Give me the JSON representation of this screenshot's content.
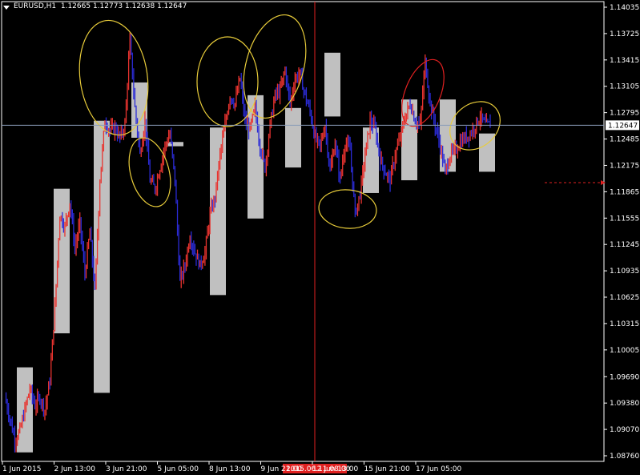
{
  "header": {
    "symbol": "EURUSD,H1",
    "ohlc": "1.12665 1.12773 1.12638 1.12647"
  },
  "colors": {
    "background": "#000000",
    "axis": "#ffffff",
    "bull_candle": "#e8332f",
    "bear_candle": "#2b2bd6",
    "box_fill": "#c0c0c0",
    "ellipse_yellow": "#e8cc3a",
    "ellipse_red": "#e02020",
    "crosshair": "#e02020",
    "current_price_line": "#8a9bb8",
    "price_tag_bg": "#ffffff"
  },
  "chart_data": {
    "type": "candlestick",
    "timeframe": "H1",
    "y_range": [
      1.0876,
      1.14035
    ],
    "price_ticks": [
      "1.14035",
      "1.13725",
      "1.13415",
      "1.13105",
      "1.12795",
      "1.12485",
      "1.12175",
      "1.11865",
      "1.11555",
      "1.11245",
      "1.10935",
      "1.10625",
      "1.10315",
      "1.10005",
      "1.09690",
      "1.09380",
      "1.09070",
      "1.08760"
    ],
    "time_ticks": [
      "1 Jun 2015",
      "2 Jun 13:00",
      "3 Jun 21:00",
      "5 Jun 05:00",
      "8 Jun 13:00",
      "9 Jun 21:00",
      "12 Jun 13:00",
      "15 Jun 21:00",
      "17 Jun 05:00"
    ],
    "current_price": "1.12647",
    "crosshair_time_label": "2015.06.11 08:00",
    "daily_range_boxes": [
      {
        "open": 1.098,
        "close": 1.088
      },
      {
        "open": 1.102,
        "close": 1.119
      },
      {
        "open": 1.095,
        "close": 1.127
      },
      {
        "open": 1.125,
        "close": 1.1315
      },
      {
        "open": 1.124,
        "close": 1.1245
      },
      {
        "open": 1.1262,
        "close": 1.1065
      },
      {
        "open": 1.1155,
        "close": 1.13
      },
      {
        "open": 1.1215,
        "close": 1.1285
      },
      {
        "open": 1.1275,
        "close": 1.135
      },
      {
        "open": 1.1262,
        "close": 1.1185
      },
      {
        "open": 1.12,
        "close": 1.1295
      },
      {
        "open": 1.121,
        "close": 1.1295
      },
      {
        "open": 1.121,
        "close": 1.1255
      },
      {
        "open": 1.1265,
        "close": 1.128
      }
    ],
    "price_path": [
      1.0945,
      1.092,
      1.0895,
      1.0905,
      1.093,
      1.0955,
      1.0935,
      1.0945,
      1.093,
      1.0965,
      1.105,
      1.116,
      1.1145,
      1.1175,
      1.112,
      1.115,
      1.109,
      1.114,
      1.107,
      1.12,
      1.127,
      1.1258,
      1.1262,
      1.125,
      1.1265,
      1.1365,
      1.1285,
      1.123,
      1.127,
      1.12,
      1.119,
      1.1215,
      1.124,
      1.1255,
      1.12,
      1.108,
      1.11,
      1.1135,
      1.1115,
      1.11,
      1.1115,
      1.116,
      1.118,
      1.123,
      1.1265,
      1.13,
      1.129,
      1.132,
      1.127,
      1.126,
      1.1285,
      1.124,
      1.1215,
      1.1265,
      1.13,
      1.1305,
      1.133,
      1.129,
      1.132,
      1.1325,
      1.13,
      1.128,
      1.125,
      1.124,
      1.1265,
      1.121,
      1.1245,
      1.12,
      1.1245,
      1.1235,
      1.116,
      1.1185,
      1.123,
      1.127,
      1.126,
      1.1225,
      1.121,
      1.12,
      1.123,
      1.125,
      1.1275,
      1.129,
      1.127,
      1.1265,
      1.134,
      1.129,
      1.1265,
      1.124,
      1.121,
      1.123,
      1.1235,
      1.1245,
      1.125,
      1.1255,
      1.1265,
      1.1275,
      1.1265,
      1.1265
    ],
    "annotations": [
      {
        "shape": "ellipse",
        "color": "yellow"
      },
      {
        "shape": "ellipse",
        "color": "yellow"
      },
      {
        "shape": "ellipse",
        "color": "yellow"
      },
      {
        "shape": "ellipse",
        "color": "yellow"
      },
      {
        "shape": "ellipse",
        "color": "yellow"
      },
      {
        "shape": "ellipse",
        "color": "red"
      },
      {
        "shape": "ellipse",
        "color": "yellow"
      }
    ]
  }
}
